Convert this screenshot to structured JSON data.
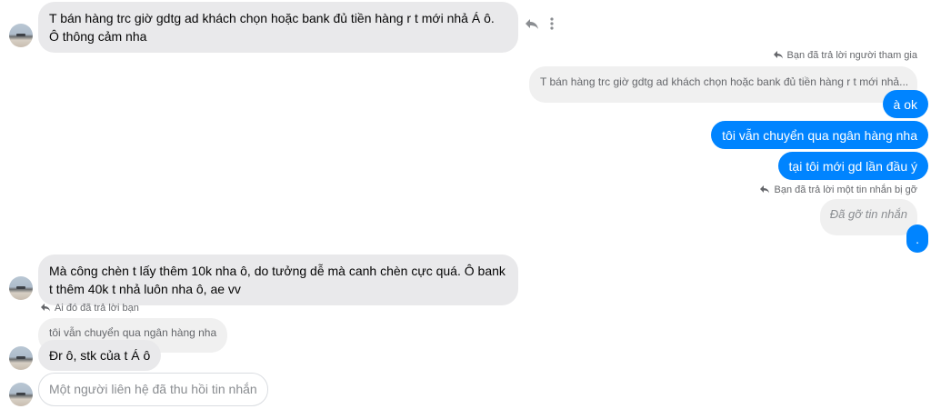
{
  "messages": {
    "m1": {
      "text": "T bán hàng trc giờ gdtg ad khách chọn hoặc bank đủ tiền hàng r t mới nhả Á ô. Ô thông cảm nha"
    },
    "reply_meta_1": "Bạn đã trả lời người tham gia",
    "reply_preview_1": "T bán hàng trc giờ gdtg ad khách chọn hoặc bank đủ tiền hàng r t mới nhả...",
    "out1": "à ok",
    "out2": "tôi vẫn chuyển qua ngân hàng nha",
    "out3": "tại tôi mới gd lần đầu ý",
    "reply_meta_2": "Bạn đã trả lời một tin nhắn bị gỡ",
    "unsent_out": "Đã gỡ tin nhắn",
    "out4": ".",
    "m2": {
      "text": "Mà công chèn t lấy thêm 10k nha ô, do tưởng dễ mà canh chèn cực quá. Ô bank t thêm 40k t nhả luôn nha ô, ae vv"
    },
    "reply_meta_3": "Ai đó đã trả lời bạn",
    "reply_preview_3": "tôi vẫn chuyển qua ngân hàng nha",
    "m3": "Đr ô, stk của t Á ô",
    "unsent_in": "Một người liên hệ đã thu hồi tin nhắn"
  },
  "icons": {
    "reply": "reply-arrow-icon",
    "more": "more-vertical-icon",
    "avatar": "contact-avatar"
  },
  "colors": {
    "outgoing": "#0084ff",
    "incoming": "#e9e9eb",
    "meta": "#65676b"
  }
}
